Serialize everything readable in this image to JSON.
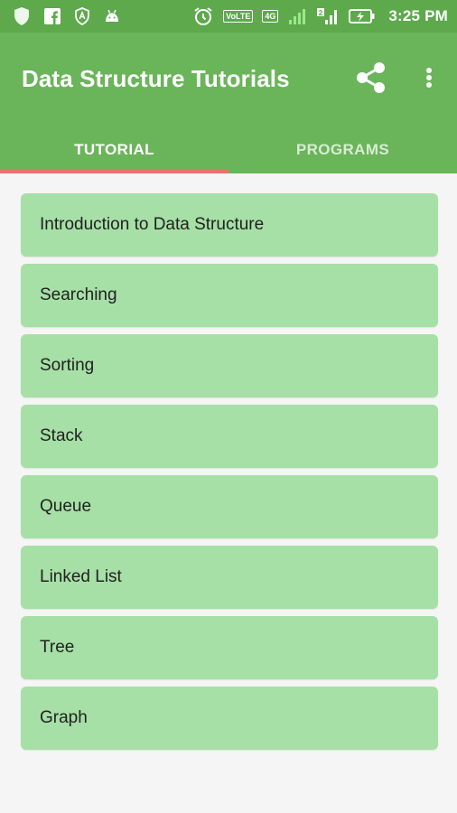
{
  "status_bar": {
    "time": "3:25 PM",
    "icons": [
      "shield-icon",
      "facebook-icon",
      "vpn-icon",
      "android-icon",
      "alarm-icon",
      "volte-icon",
      "4g-icon",
      "signal-icon",
      "signal-2-icon",
      "battery-charging-icon"
    ],
    "volte_label": "VoLTE",
    "network_label": "4G"
  },
  "app_bar": {
    "title": "Data Structure Tutorials",
    "color": "#6ab45a",
    "actions": [
      "share-icon",
      "more-vert-icon"
    ]
  },
  "tabs": [
    {
      "label": "TUTORIAL",
      "active": true
    },
    {
      "label": "PROGRAMS",
      "active": false
    }
  ],
  "indicator_color": "#e57373",
  "topics": [
    {
      "label": "Introduction to Data Structure"
    },
    {
      "label": "Searching"
    },
    {
      "label": "Sorting"
    },
    {
      "label": "Stack"
    },
    {
      "label": "Queue"
    },
    {
      "label": "Linked List"
    },
    {
      "label": "Tree"
    },
    {
      "label": "Graph"
    }
  ],
  "item_color": "#a6e0a6"
}
